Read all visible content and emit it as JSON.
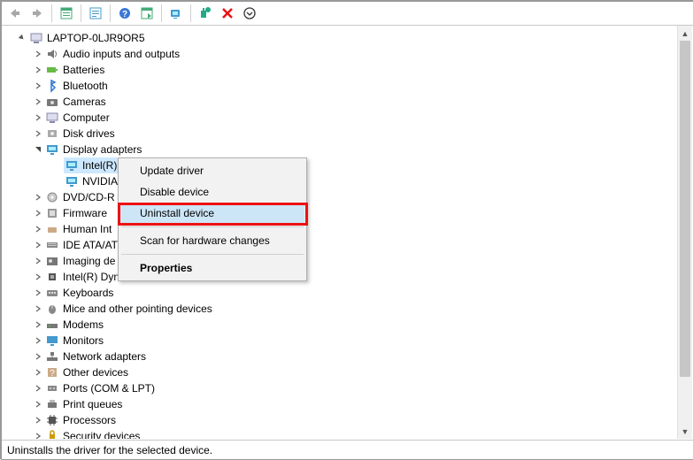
{
  "toolbar": {
    "back": "Back",
    "forward": "Forward",
    "show_hidden": "Show hidden devices",
    "properties": "Properties",
    "help": "Help",
    "action": "Action",
    "view": "View",
    "scan": "Scan for hardware changes",
    "remove": "Uninstall device",
    "add": "Add legacy hardware"
  },
  "tree": {
    "root": {
      "expanded": true,
      "label": "LAPTOP-0LJR9OR5"
    },
    "items": [
      {
        "exp": ">",
        "label": "Audio inputs and outputs",
        "icon": "speaker"
      },
      {
        "exp": ">",
        "label": "Batteries",
        "icon": "battery"
      },
      {
        "exp": ">",
        "label": "Bluetooth",
        "icon": "bluetooth"
      },
      {
        "exp": ">",
        "label": "Cameras",
        "icon": "camera"
      },
      {
        "exp": ">",
        "label": "Computer",
        "icon": "computer"
      },
      {
        "exp": ">",
        "label": "Disk drives",
        "icon": "disk"
      },
      {
        "exp": "v",
        "label": "Display adapters",
        "icon": "display",
        "children": [
          {
            "label": "Intel(R)",
            "icon": "display",
            "selected": true
          },
          {
            "label": "NVIDIA",
            "icon": "display"
          }
        ]
      },
      {
        "exp": ">",
        "label": "DVD/CD-R",
        "icon": "dvd"
      },
      {
        "exp": ">",
        "label": "Firmware",
        "icon": "firmware"
      },
      {
        "exp": ">",
        "label": "Human Int",
        "icon": "hid"
      },
      {
        "exp": ">",
        "label": "IDE ATA/AT",
        "icon": "ide"
      },
      {
        "exp": ">",
        "label": "Imaging de",
        "icon": "imaging"
      },
      {
        "exp": ">",
        "label": "Intel(R) Dynamic Platform and Thermal Framework",
        "icon": "chip"
      },
      {
        "exp": ">",
        "label": "Keyboards",
        "icon": "keyboard"
      },
      {
        "exp": ">",
        "label": "Mice and other pointing devices",
        "icon": "mouse"
      },
      {
        "exp": ">",
        "label": "Modems",
        "icon": "modem"
      },
      {
        "exp": ">",
        "label": "Monitors",
        "icon": "monitor"
      },
      {
        "exp": ">",
        "label": "Network adapters",
        "icon": "network"
      },
      {
        "exp": ">",
        "label": "Other devices",
        "icon": "other"
      },
      {
        "exp": ">",
        "label": "Ports (COM & LPT)",
        "icon": "port"
      },
      {
        "exp": ">",
        "label": "Print queues",
        "icon": "printer"
      },
      {
        "exp": ">",
        "label": "Processors",
        "icon": "cpu"
      },
      {
        "exp": ">",
        "label": "Security devices",
        "icon": "security"
      }
    ]
  },
  "context_menu": {
    "items": [
      {
        "label": "Update driver",
        "type": "item"
      },
      {
        "label": "Disable device",
        "type": "item"
      },
      {
        "label": "Uninstall device",
        "type": "item",
        "hover": true,
        "highlighted": true
      },
      {
        "type": "sep"
      },
      {
        "label": "Scan for hardware changes",
        "type": "item"
      },
      {
        "type": "sep"
      },
      {
        "label": "Properties",
        "type": "item",
        "bold": true
      }
    ]
  },
  "statusbar": {
    "text": "Uninstalls the driver for the selected device."
  },
  "colors": {
    "highlight_border": "#e11",
    "selection_bg": "#cde8ff",
    "menu_hover": "#cde6f7"
  }
}
